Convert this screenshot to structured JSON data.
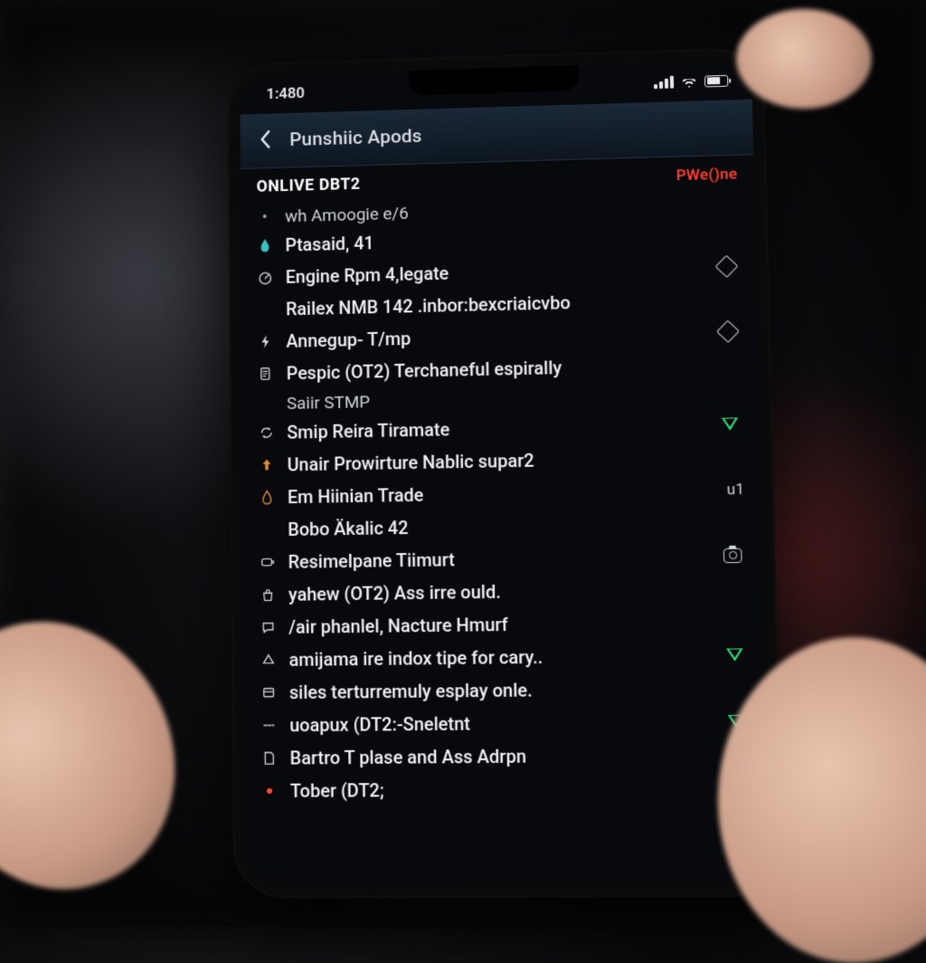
{
  "statusbar": {
    "time": "1:480"
  },
  "navbar": {
    "title": "Punshiic Apods"
  },
  "section": {
    "header": "ONLIVE DBT2",
    "status_tag": "PWe()ne"
  },
  "rows": [
    {
      "icon": "dot",
      "label": "wh Amoogie e/6",
      "label_class": "dim",
      "trail": ""
    },
    {
      "icon": "water-teal",
      "label": "Ptasaid, 41",
      "trail": ""
    },
    {
      "icon": "gauge",
      "label": "Engine Rpm 4,legate",
      "trail": "diamond"
    },
    {
      "icon": "",
      "label": "Railex NMB 142 .inbor:bexcriaicvbo",
      "trail": ""
    },
    {
      "icon": "bolt",
      "label": "Annegup- T/mp",
      "trail": "diamond"
    },
    {
      "icon": "doc",
      "label": "Pespic (OT2) Terchaneful espirally",
      "trail": ""
    },
    {
      "icon": "",
      "label": "Saiir STMP",
      "label_class": "dim",
      "trail": ""
    },
    {
      "icon": "loop",
      "label": "Smip Reira Tiramate",
      "trail": "tri-green"
    },
    {
      "icon": "up-orange",
      "label": "Unair Prowirture Nablic supar2",
      "trail": ""
    },
    {
      "icon": "drop-orange",
      "label": "Em Hiinian Trade",
      "trail": "text:u1"
    },
    {
      "icon": "",
      "label": "Bobo Äkalic 42",
      "trail": ""
    },
    {
      "icon": "battery",
      "label": "Resimelpane Tiimurt",
      "trail": "camera"
    },
    {
      "icon": "bag",
      "label": "yahew (OT2) Ass irre ould.",
      "trail": ""
    },
    {
      "icon": "chat",
      "label": "/air phanlel, Nacture Hmurf",
      "trail": ""
    },
    {
      "icon": "tri-up",
      "label": "amijama ire indox tipe for cary..",
      "trail": "tri-green"
    },
    {
      "icon": "box",
      "label": "siles terturremuly esplay onle.",
      "trail": ""
    },
    {
      "icon": "dash",
      "label": "uoapux (DT2:-Sneletnt",
      "trail": "tri-green"
    },
    {
      "icon": "page",
      "label": "Bartro T plase and Ass Adrpn",
      "trail": ""
    },
    {
      "icon": "red-dot",
      "label": "Tober (DT2;",
      "trail": ""
    }
  ],
  "colors": {
    "accent_red": "#ff3b30",
    "accent_green": "#2fe07a",
    "accent_teal": "#3ac0c0"
  }
}
